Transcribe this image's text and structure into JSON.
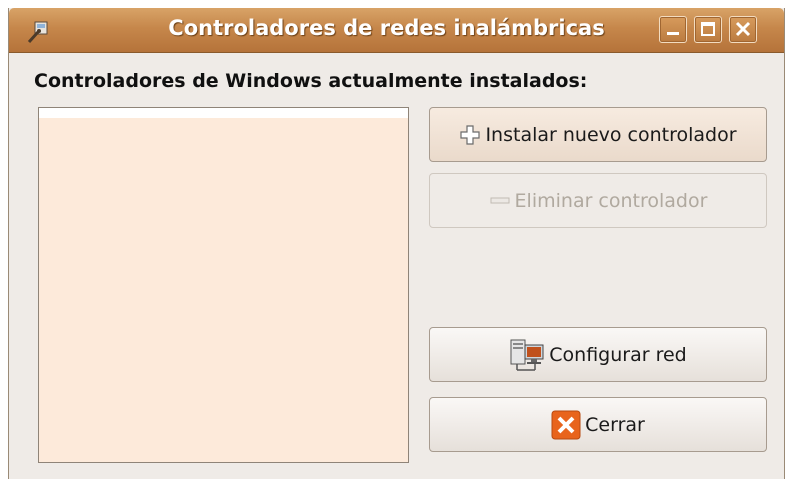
{
  "window": {
    "title": "Controladores de redes inalámbricas"
  },
  "main": {
    "section_label": "Controladores de Windows actualmente instalados:",
    "drivers": []
  },
  "buttons": {
    "install": "Instalar nuevo controlador",
    "remove": "Eliminar controlador",
    "configure": "Configurar red",
    "close": "Cerrar"
  },
  "icons": {
    "app": "wireless-tool-icon",
    "install": "plus-icon",
    "remove": "minus-icon",
    "configure": "network-config-icon",
    "close": "close-x-icon"
  },
  "colors": {
    "titlebar": "#c6874b",
    "list_background": "#fdeada",
    "close_icon": "#e8641c"
  }
}
